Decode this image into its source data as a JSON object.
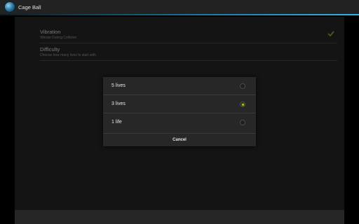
{
  "app": {
    "title": "Cage Ball"
  },
  "settings": {
    "vibration": {
      "title": "Vibration",
      "summary": "Vibrate During Collision",
      "checked": true
    },
    "difficulty": {
      "title": "Difficulty",
      "summary": "Choose how many lives to start with"
    }
  },
  "dialog": {
    "options": [
      {
        "label": "5 lives",
        "selected": false
      },
      {
        "label": "3 lives",
        "selected": true
      },
      {
        "label": "1 life",
        "selected": false
      }
    ],
    "cancel_label": "Cancel"
  },
  "colors": {
    "accent": "#99cc00",
    "holo_blue": "#33b5e5"
  }
}
